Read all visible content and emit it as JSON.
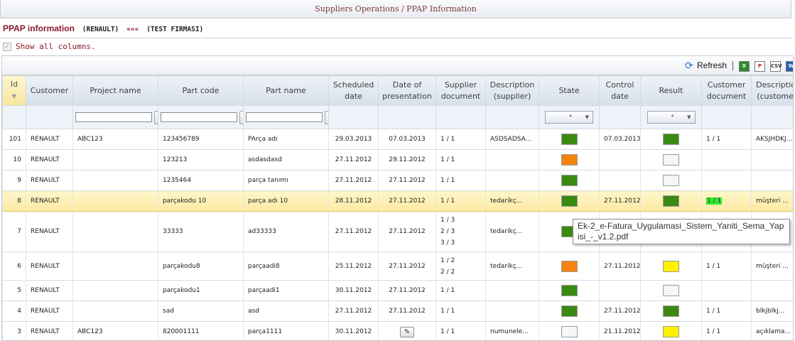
{
  "page_title": "Suppliers Operations / PPAP Information",
  "info": {
    "title": "PPAP information",
    "customer": "(RENAULT)",
    "arrows": "«««",
    "firm": "(TEST FIRMASI)"
  },
  "show_all_columns": {
    "label": "Show all columns.",
    "checked": true
  },
  "toolbar": {
    "refresh_label": "Refresh",
    "export_icons": [
      "excel-icon",
      "pdf-icon",
      "csv-icon",
      "word-icon"
    ]
  },
  "columns": {
    "id": "Id",
    "customer": "Customer",
    "project_name": "Project name",
    "part_code": "Part code",
    "part_name": "Part name",
    "scheduled_date": "Scheduled date",
    "date_of_presentation": "Date of presentation",
    "supplier_document": "Supplier document",
    "description_supplier": "Description (supplier)",
    "state": "State",
    "control_date": "Control date",
    "result": "Result",
    "customer_document": "Customer document",
    "description_customer": "Description (customer)"
  },
  "filters": {
    "state_select": "*",
    "result_select": "*"
  },
  "status_colors": {
    "green": "#3a8a12",
    "orange": "#f5830f",
    "yellow": "#fff200",
    "empty": "#f4f6f8"
  },
  "rows": [
    {
      "id": "101",
      "customer": "RENAULT",
      "project": "ABC123",
      "part_code": "123456789",
      "part_name": "PArça adı",
      "scheduled": "29.03.2013",
      "presentation": "07.03.2013",
      "supplier_doc": "1 / 1",
      "desc_supplier": "ASDSADSA...",
      "state": "green",
      "control_date": "07.03.2013",
      "result": "green",
      "customer_doc": "1 / 1",
      "desc_customer": "AKSJHDKJ..."
    },
    {
      "id": "10",
      "customer": "RENAULT",
      "project": "",
      "part_code": "123213",
      "part_name": "asdasdasd",
      "scheduled": "27.11.2012",
      "presentation": "29.11.2012",
      "supplier_doc": "1 / 1",
      "desc_supplier": "",
      "state": "orange",
      "control_date": "",
      "result": "empty",
      "customer_doc": "",
      "desc_customer": ""
    },
    {
      "id": "9",
      "customer": "RENAULT",
      "project": "",
      "part_code": "1235464",
      "part_name": "parça tanımı",
      "scheduled": "27.11.2012",
      "presentation": "27.11.2012",
      "supplier_doc": "1 / 1",
      "desc_supplier": "",
      "state": "green",
      "control_date": "",
      "result": "empty",
      "customer_doc": "",
      "desc_customer": ""
    },
    {
      "id": "8",
      "customer": "RENAULT",
      "project": "",
      "part_code": "parçakodu 10",
      "part_name": "parça adı 10",
      "scheduled": "28.11.2012",
      "presentation": "27.11.2012",
      "supplier_doc": "1 / 1",
      "desc_supplier": "tedarikç...",
      "state": "green",
      "control_date": "27.11.2012",
      "result": "green",
      "customer_doc": "1 / 1",
      "desc_customer": "müşteri ..."
    },
    {
      "id": "7",
      "customer": "RENAULT",
      "project": "",
      "part_code": "33333",
      "part_name": "ad33333",
      "scheduled": "27.11.2012",
      "presentation": "27.11.2012",
      "supplier_doc_lines": [
        "1 / 3",
        "2 / 3",
        "3 / 3"
      ],
      "desc_supplier": "tedarikç...",
      "state": "green",
      "control_date": "",
      "result": "",
      "customer_doc": "",
      "desc_customer": ""
    },
    {
      "id": "6",
      "customer": "RENAULT",
      "project": "",
      "part_code": "parçakodu8",
      "part_name": "parçaadi8",
      "scheduled": "25.11.2012",
      "presentation": "27.11.2012",
      "supplier_doc_lines": [
        "1 / 2",
        "2 / 2"
      ],
      "desc_supplier": "tedarikç...",
      "state": "orange",
      "control_date": "27.11.2012",
      "result": "yellow",
      "customer_doc": "1 / 1",
      "desc_customer": "müşteri ..."
    },
    {
      "id": "5",
      "customer": "RENAULT",
      "project": "",
      "part_code": "parçakodu1",
      "part_name": "parçaadi1",
      "scheduled": "30.11.2012",
      "presentation": "27.11.2012",
      "supplier_doc": "1 / 1",
      "desc_supplier": "",
      "state": "green",
      "control_date": "",
      "result": "empty",
      "customer_doc": "",
      "desc_customer": ""
    },
    {
      "id": "4",
      "customer": "RENAULT",
      "project": "",
      "part_code": "sad",
      "part_name": "asd",
      "scheduled": "27.11.2012",
      "presentation": "27.11.2012",
      "supplier_doc": "1 / 1",
      "desc_supplier": "",
      "state": "green",
      "control_date": "27.11.2012",
      "result": "green",
      "customer_doc": "1 / 1",
      "desc_customer": "blkjblkj..."
    },
    {
      "id": "3",
      "customer": "RENAULT",
      "project": "ABC123",
      "part_code": "820001111",
      "part_name": "parça1111",
      "scheduled": "30.11.2012",
      "presentation": "",
      "supplier_doc": "1 / 1",
      "desc_supplier": "numunele...",
      "state": "empty",
      "control_date": "21.11.2012",
      "result": "yellow",
      "customer_doc": "1 / 1",
      "desc_customer": "açıklama..."
    }
  ],
  "tooltip": {
    "text": "Ek-2_e-Fatura_Uygulamasi_Sistem_Yaniti_Sema_Yapisi_-_v1.2.pdf"
  }
}
